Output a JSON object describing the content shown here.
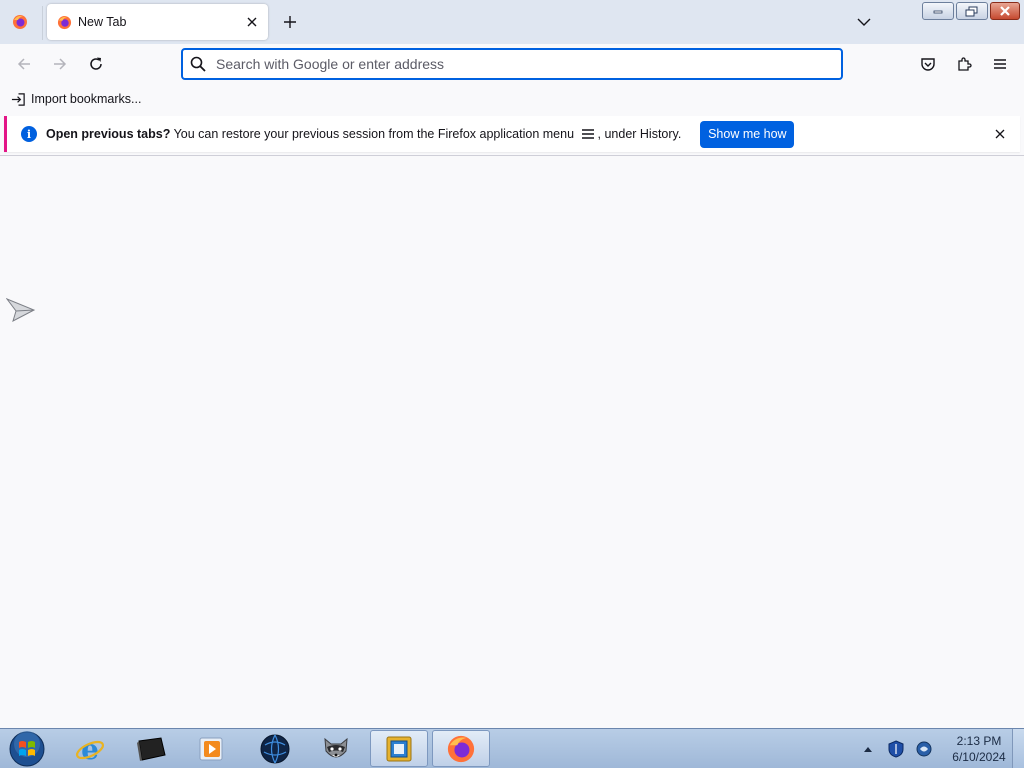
{
  "tabs": [
    {
      "label": "New Tab",
      "active": true
    }
  ],
  "navbar": {
    "search_placeholder": "Search with Google or enter address"
  },
  "bookmarks_toolbar": {
    "import_label": "Import bookmarks..."
  },
  "notification": {
    "text_bold": "Open previous tabs?",
    "text_before_icon": " You can restore your previous session from the Firefox application menu ",
    "text_after_icon": ", under History.",
    "button_label": "Show me how"
  },
  "taskbar": {
    "apps": [
      "internet-explorer",
      "terminal",
      "media-player",
      "globe",
      "raccoon",
      "file-manager",
      "firefox"
    ],
    "active_app": "firefox",
    "clock_time": "2:13 PM",
    "clock_date": "6/10/2024"
  },
  "colors": {
    "accent": "#0061e0",
    "notification_stripe": "#e31587",
    "tabstrip_bg": "#dfe6f1"
  }
}
